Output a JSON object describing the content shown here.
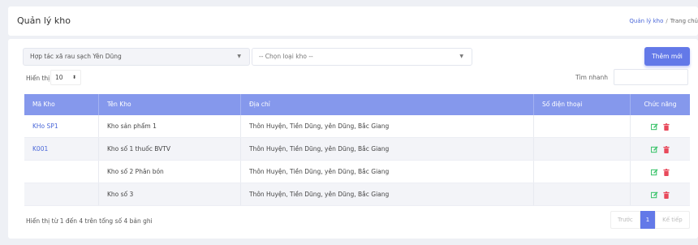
{
  "header": {
    "title": "Quản lý kho",
    "breadcrumb": {
      "link": "Quản lý kho",
      "separator": "/",
      "current": "Trang chủ"
    }
  },
  "filters": {
    "coop_select": "Hợp tác xã rau sạch Yên Dũng",
    "kho_select": "-- Chọn loại kho --",
    "add_button": "Thêm mới",
    "show_label": "Hiển thị",
    "page_size": "10",
    "quick_search_label": "Tìm nhanh",
    "quick_search_value": ""
  },
  "table": {
    "columns": [
      "Mã Kho",
      "Tên Kho",
      "Địa chỉ",
      "Số điện thoại",
      "Chức năng"
    ],
    "rows": [
      {
        "code": "KHo SP1",
        "name": "Kho sản phẩm 1",
        "address": "Thôn Huyện, Tiền Dũng, yên Dũng, Bắc Giang",
        "phone": ""
      },
      {
        "code": "K001",
        "name": "Kho số 1 thuốc BVTV",
        "address": "Thôn Huyện, Tiền Dũng, yên Dũng, Bắc Giang",
        "phone": ""
      },
      {
        "code": "",
        "name": "Kho số 2 Phân bón",
        "address": "Thôn Huyện, Tiền Dũng, yên Dũng, Bắc Giang",
        "phone": ""
      },
      {
        "code": "",
        "name": "Kho số 3",
        "address": "Thôn Huyện, Tiền Dũng, yên Dũng, Bắc Giang",
        "phone": ""
      }
    ]
  },
  "footer": {
    "summary": "Hiển thị từ 1 đến 4 trên tổng số 4 bản ghi",
    "prev": "Trước",
    "page": "1",
    "next": "Kế tiếp"
  },
  "colors": {
    "accent": "#6379e8",
    "header_bg": "#8598ec",
    "edit_icon": "#3ec46d",
    "delete_icon": "#e8495b"
  },
  "icons": {
    "edit": "edit-icon",
    "delete": "trash-icon",
    "select_arrow": "chevron-down-icon",
    "stepper": "up-down-icon"
  }
}
